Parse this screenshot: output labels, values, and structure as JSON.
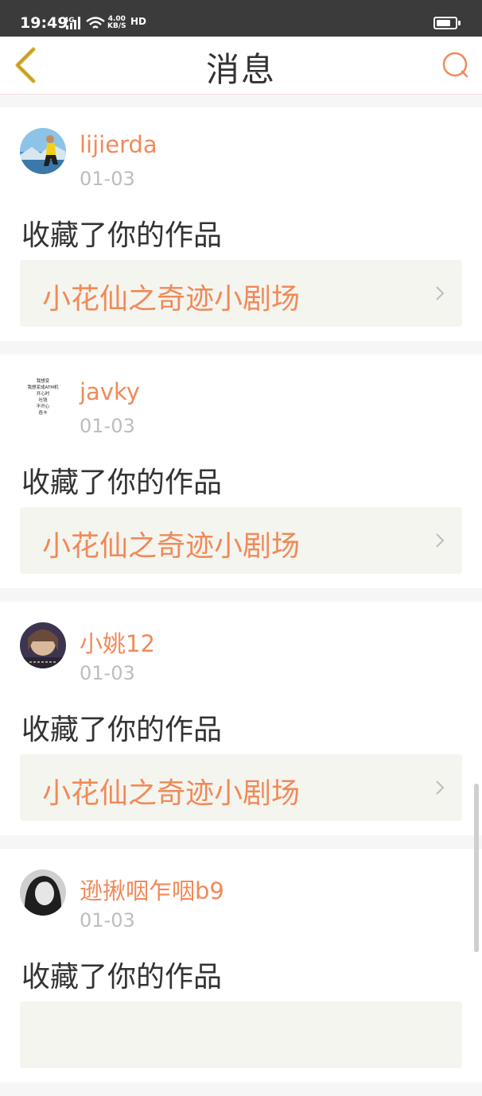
{
  "status_bar": {
    "time": "19:49",
    "network": "4G",
    "speed_value": "4.00",
    "speed_unit": "KB/S",
    "hd": "HD",
    "battery_level": 0.75
  },
  "header": {
    "title": "消息",
    "back_icon": "chevron-left-icon",
    "search_icon": "search-icon"
  },
  "notifications": [
    {
      "username": "lijierda",
      "date": "01-03",
      "action": "收藏了你的作品",
      "work_title": "小花仙之奇迹小剧场"
    },
    {
      "username": "javky",
      "date": "01-03",
      "action": "收藏了你的作品",
      "work_title": "小花仙之奇迹小剧场",
      "avatar_text": [
        "我想变",
        "我想变成ATM机",
        "开心时",
        "吐钱",
        "不开心",
        "吞卡"
      ]
    },
    {
      "username": "小姚12",
      "date": "01-03",
      "action": "收藏了你的作品",
      "work_title": "小花仙之奇迹小剧场"
    },
    {
      "username": "逊揪咽乍咽b9",
      "date": "01-03",
      "action": "收藏了你的作品",
      "work_title": ""
    }
  ],
  "colors": {
    "accent": "#f08a59",
    "status_bar_bg": "#3b3b3b",
    "back_icon": "#d9b12e",
    "link_bg": "#f5f5ef"
  }
}
